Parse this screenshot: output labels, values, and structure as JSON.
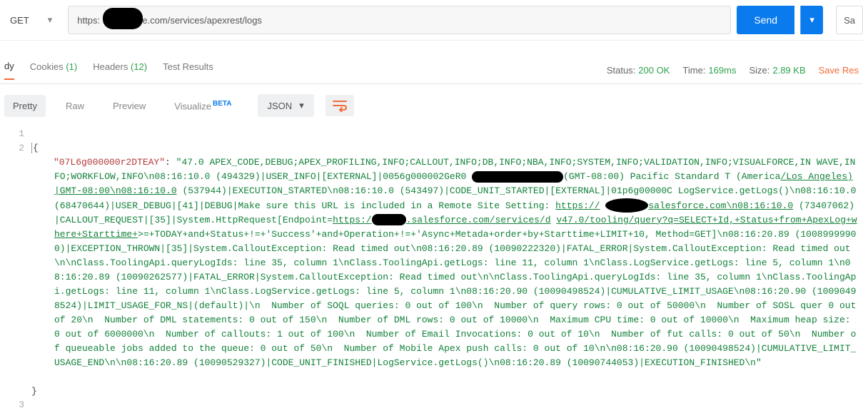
{
  "topbar": {
    "method": "GET",
    "url": "https:            .salesforce.com/services/apexrest/logs",
    "send_label": "Send",
    "save_label": "Sa"
  },
  "tabs": {
    "body": "dy",
    "cookies_label": "Cookies",
    "cookies_count": "(1)",
    "headers_label": "Headers",
    "headers_count": "(12)",
    "test_results": "Test Results"
  },
  "status_bar": {
    "status_label": "Status:",
    "status_value": "200 OK",
    "time_label": "Time:",
    "time_value": "169ms",
    "size_label": "Size:",
    "size_value": "2.89 KB",
    "save_response": "Save Res"
  },
  "viewbar": {
    "pretty": "Pretty",
    "raw": "Raw",
    "preview": "Preview",
    "visualize": "Visualize",
    "beta": "BETA",
    "format": "JSON"
  },
  "gutter": {
    "l1": "1",
    "l2": "2",
    "l3": "3"
  },
  "code": {
    "open_brace": "{",
    "key": "\"07L6g000000r2DTEAY\"",
    "colon": ": ",
    "seg1": "\"47.0 APEX_CODE,DEBUG;APEX_PROFILING,INFO;CALLOUT,INFO;DB,INFO;NBA,INFO;SYSTEM,INFO;VALIDATION,INFO;VISUALFORCE,IN",
    "seg2": "WAVE,INFO;WORKFLOW,INFO\\n08:16:10.0 (494329)|USER_INFO|[EXTERNAL]|0056g000002GeR0",
    "seg3": "(GMT-08:00) Pacific Standard T",
    "seg4": "(America",
    "seg4u": "/Los_Angeles)|GMT-08:00\\n08:16:10.0",
    "seg5": " (537944)|EXECUTION_STARTED\\n08:16:10.0 (543497)|CODE_UNIT_STARTED|[EXTERNAL]|01p6g00000C",
    "seg6": "LogService.getLogs()\\n08:16:10.0 (68470644)|USER_DEBUG|[41]|DEBUG|Make sure this URL is included in a Remote Site Setting: ",
    "seg6u": "https://",
    "seg7u": "salesforce.com\\n08:16:10.0",
    "seg8": " (73407062)|CALLOUT_REQUEST|[35]|System.HttpRequest[Endpoint=",
    "seg8u": "https:/",
    "seg9u": ".salesforce.com/services/d",
    "seg10u": "v47.0/tooling/query?q=SELECT+Id,+Status+from+ApexLog+where+Starttime+",
    "seg10b": ">=+TODAY+and+Status+!=+'Success'+and+Operation+!=+'Async+Metada+order+by+Starttime+LIMIT+10, Method=GET]\\n08:16:20.89 (10089999900)|EXCEPTION_THROWN|[35]|System.CalloutException: Read timed out\\n08:16:20.89 (10090222320)|FATAL_ERROR|System.CalloutException: Read timed out\\n\\nClass.ToolingApi.queryLogIds: line 35, column 1\\nClass.ToolingApi.getLogs: line 11, column 1\\nClass.LogService.getLogs: line 5, column 1\\n08:16:20.89 (10090262577)|FATAL_ERROR|System.CalloutException: Read timed out\\n\\nClass.ToolingApi.queryLogIds: line 35, column 1\\nClass.ToolingApi.getLogs: line 11, column 1\\nClass.LogService.getLogs: line 5, column 1\\n08:16:20.90 (10090498524)|CUMULATIVE_LIMIT_USAGE\\n08:16:20.90 (10090498524)|LIMIT_USAGE_FOR_NS|(default)|\\n  Number of SOQL queries: 0 out of 100\\n  Number of query rows: 0 out of 50000\\n  Number of SOSL quer 0 out of 20\\n  Number of DML statements: 0 out of 150\\n  Number of DML rows: 0 out of 10000\\n  Maximum CPU time: 0 out of 10000\\n  Maximum heap size: 0 out of 6000000\\n  Number of callouts: 1 out of 100\\n  Number of Email Invocations: 0 out of 10\\n  Number of fut calls: 0 out of 50\\n  Number of queueable jobs added to the queue: 0 out of 50\\n  Number of Mobile Apex push calls: 0 out of 10\\n\\n08:16:20.90 (10090498524)|CUMULATIVE_LIMIT_USAGE_END\\n\\n08:16:20.89 (10090529327)|CODE_UNIT_FINISHED|LogService.getLogs()\\n08:16:20.89 (10090744053)|EXECUTION_FINISHED\\n\"",
    "close_brace": "}"
  }
}
